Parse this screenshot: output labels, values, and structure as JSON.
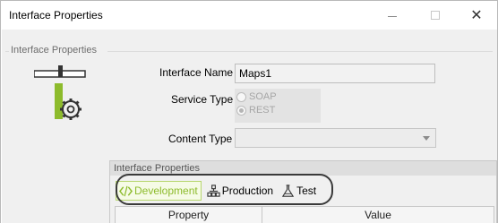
{
  "window": {
    "title": "Interface Properties",
    "minimize_icon": "minimize-icon",
    "maximize_icon": "maximize-icon",
    "close_glyph": "✕"
  },
  "group": {
    "legend": "Interface Properties"
  },
  "form": {
    "interface_name_label": "Interface Name",
    "interface_name_value": "Maps1",
    "service_type_label": "Service Type",
    "service_type_options": [
      {
        "label": "SOAP",
        "selected": false
      },
      {
        "label": "REST",
        "selected": true
      }
    ],
    "content_type_label": "Content Type",
    "content_type_value": ""
  },
  "panel": {
    "title": "Interface Properties",
    "tabs": [
      {
        "label": "Development",
        "icon": "code-icon",
        "active": true
      },
      {
        "label": "Production",
        "icon": "production-icon",
        "active": false
      },
      {
        "label": "Test",
        "icon": "flask-icon",
        "active": false
      }
    ],
    "columns": [
      "Property",
      "Value"
    ]
  },
  "colors": {
    "active_tab": "#8dbb2c",
    "emblem_green": "#8dbb2c"
  }
}
